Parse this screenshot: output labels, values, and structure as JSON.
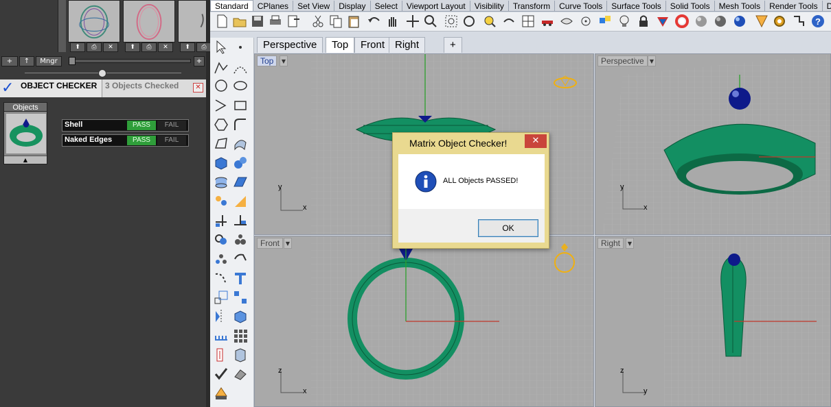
{
  "left_panel": {
    "thumb_buttons": [
      "⬆",
      "⎙",
      "✕"
    ],
    "nav": {
      "add": "+",
      "up": "↑",
      "manager": "Mngr",
      "right_add": "+"
    },
    "checker": {
      "title": "OBJECT CHECKER",
      "status": "3 Objects Checked",
      "close": "✕"
    },
    "objects_label": "Objects",
    "expand_arrow": "▲",
    "checks": [
      {
        "label": "Shell",
        "pass": "PASS",
        "fail": "FAIL",
        "result": "pass"
      },
      {
        "label": "Naked Edges",
        "pass": "PASS",
        "fail": "FAIL",
        "result": "pass"
      }
    ]
  },
  "rhino": {
    "toolbar_tabs": [
      "Standard",
      "CPlanes",
      "Set View",
      "Display",
      "Select",
      "Viewport Layout",
      "Visibility",
      "Transform",
      "Curve Tools",
      "Surface Tools",
      "Solid Tools",
      "Mesh Tools",
      "Render Tools",
      "D"
    ],
    "active_toolbar_tab": "Standard",
    "viewport_tabs": [
      "Perspective",
      "Top",
      "Front",
      "Right",
      "+"
    ],
    "active_viewport_tab": "Top",
    "viewports": {
      "top": {
        "label": "Top",
        "axis_h": "x",
        "axis_v": "y"
      },
      "perspective": {
        "label": "Perspective",
        "axis_h": "x",
        "axis_v": "y"
      },
      "front": {
        "label": "Front",
        "axis_h": "x",
        "axis_v": "z"
      },
      "right": {
        "label": "Right",
        "axis_h": "y",
        "axis_v": "z"
      }
    },
    "colors": {
      "ring": "#0f8a5a",
      "gem": "#0e1a8a",
      "axis_x": "#c0392b",
      "axis_y": "#2ca02c",
      "viewport_bg": "#a9a9a9",
      "grid_line": "#bcbcbc"
    }
  },
  "dialog": {
    "title": "Matrix Object Checker!",
    "message": "ALL Objects PASSED!",
    "ok_label": "OK",
    "close": "✕"
  }
}
